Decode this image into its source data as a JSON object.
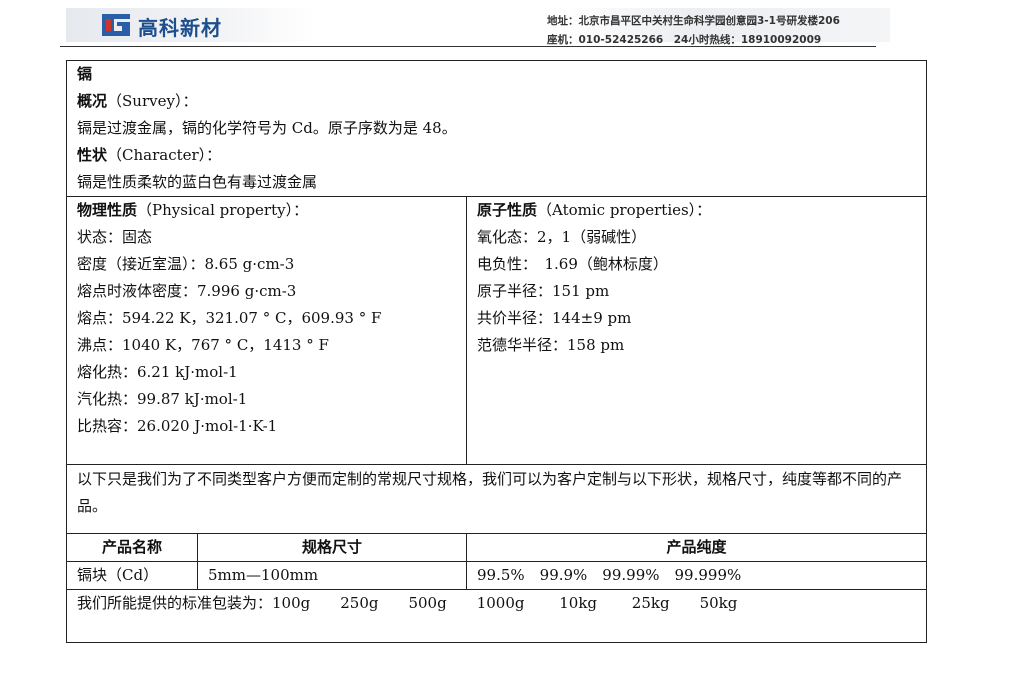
{
  "header": {
    "company": "高科新材",
    "address": "地址：北京市昌平区中关村生命科学园创意园3-1号研发楼206",
    "phones": "座机：010-52425266　24小时热线：18910092009"
  },
  "element": {
    "name": "镉",
    "survey_heading": "概况",
    "survey_en": "（Survey）：",
    "survey_text": "镉是过渡金属，镉的化学符号为 Cd。原子序数为是 48。",
    "character_heading": "性状",
    "character_en": "（Character）：",
    "character_text": "镉是性质柔软的蓝白色有毒过渡金属"
  },
  "physical": {
    "heading": "物理性质",
    "heading_en": "（Physical property）：",
    "rows": [
      "状态：固态",
      "密度（接近室温）：8.65 g·cm-3",
      "熔点时液体密度：7.996 g·cm-3",
      "熔点：594.22 K，321.07 ° C，609.93 ° F",
      "沸点：1040 K，767 ° C，1413 ° F",
      "熔化热：6.21 kJ·mol-1",
      "汽化热：99.87 kJ·mol-1",
      "比热容：26.020 J·mol-1·K-1"
    ]
  },
  "atomic": {
    "heading": "原子性质",
    "heading_en": "（Atomic properties）：",
    "rows": [
      "氧化态：2，1（弱碱性）",
      "电负性：　1.69（鲍林标度）",
      "原子半径：151 pm",
      "共价半径：144±9 pm",
      "范德华半径：158 pm"
    ]
  },
  "note": "以下只是我们为了不同类型客户方便而定制的常规尺寸规格，我们可以为客户定制与以下形状，规格尺寸，纯度等都不同的产品。",
  "product_table": {
    "headers": [
      "产品名称",
      "规格尺寸",
      "产品纯度"
    ],
    "row": {
      "name": "镉块（Cd）",
      "size": "5mm—100mm",
      "purity": "99.5%　99.9%　99.99%　99.999%"
    }
  },
  "packaging": "我们所能提供的标准包装为：100g　　250g　　500g　　1000g　　 10kg　　 25kg　　50kg"
}
